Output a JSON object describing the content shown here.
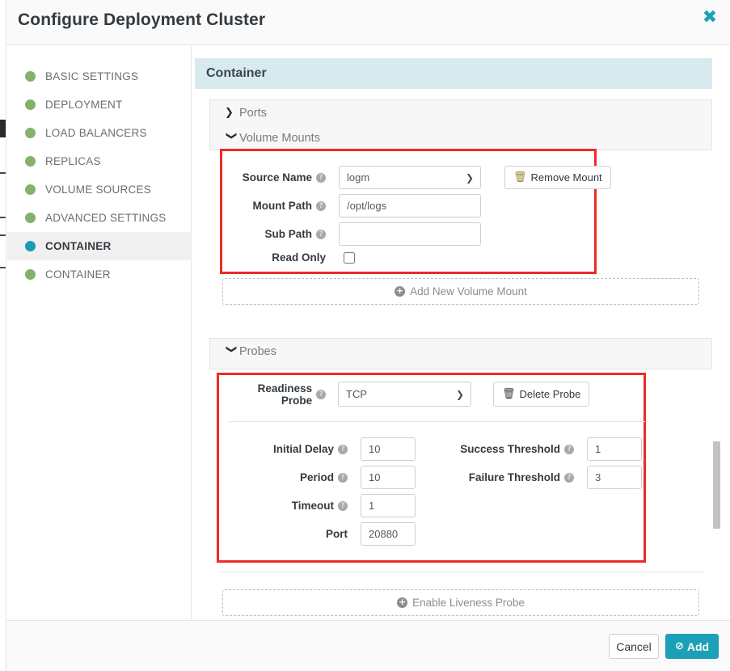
{
  "dialog": {
    "title": "Configure Deployment Cluster",
    "close_icon": "close-icon",
    "close_glyph": "✖"
  },
  "sidebar": {
    "items": [
      {
        "label": "BASIC SETTINGS",
        "status_color": "#84b269",
        "active": false
      },
      {
        "label": "DEPLOYMENT",
        "status_color": "#84b269",
        "active": false
      },
      {
        "label": "LOAD BALANCERS",
        "status_color": "#84b269",
        "active": false
      },
      {
        "label": "REPLICAS",
        "status_color": "#84b269",
        "active": false
      },
      {
        "label": "VOLUME SOURCES",
        "status_color": "#84b269",
        "active": false
      },
      {
        "label": "ADVANCED SETTINGS",
        "status_color": "#84b269",
        "active": false
      },
      {
        "label": "CONTAINER",
        "status_color": "#1b9cb5",
        "active": true
      },
      {
        "label": "CONTAINER",
        "status_color": "#84b269",
        "active": false
      }
    ]
  },
  "main": {
    "section_title": "Container",
    "accordions": {
      "ports": {
        "label": "Ports",
        "expanded": false,
        "chevron": "❯"
      },
      "volume_mounts": {
        "label": "Volume Mounts",
        "expanded": true,
        "chevron": "❯"
      },
      "probes": {
        "label": "Probes",
        "expanded": true,
        "chevron": "❯"
      }
    },
    "volume_mount": {
      "source_name": {
        "label": "Source Name",
        "value": "logm",
        "help": "?"
      },
      "mount_path": {
        "label": "Mount Path",
        "value": "/opt/logs",
        "help": "?"
      },
      "sub_path": {
        "label": "Sub Path",
        "value": "",
        "help": "?"
      },
      "read_only": {
        "label": "Read Only",
        "checked": false
      },
      "remove_button": {
        "label": "Remove Mount",
        "icon": "trash-icon",
        "glyph": "🗑"
      },
      "add_button": {
        "label": "Add New Volume Mount",
        "icon": "plus-circle-icon",
        "glyph": "+"
      }
    },
    "probes": {
      "readiness": {
        "label": "Readiness Probe",
        "value": "TCP",
        "help": "?",
        "delete_button": {
          "label": "Delete Probe",
          "icon": "trash-icon",
          "glyph": "🗑"
        }
      },
      "fields_left": [
        {
          "label": "Initial Delay",
          "value": "10",
          "help": "?"
        },
        {
          "label": "Period",
          "value": "10",
          "help": "?"
        },
        {
          "label": "Timeout",
          "value": "1",
          "help": "?"
        },
        {
          "label": "Port",
          "value": "20880",
          "help": ""
        }
      ],
      "fields_right": [
        {
          "label": "Success Threshold",
          "value": "1",
          "help": "?"
        },
        {
          "label": "Failure Threshold",
          "value": "3",
          "help": "?"
        }
      ],
      "liveness_button": {
        "label": "Enable Liveness Probe",
        "icon": "plus-circle-icon",
        "glyph": "+"
      }
    }
  },
  "footer": {
    "cancel_label": "Cancel",
    "add_label": "Add",
    "add_icon": "check-circle-icon",
    "add_glyph": "⊘"
  },
  "colors": {
    "accent_teal": "#1ba0b8",
    "status_green": "#84b269",
    "highlight_red": "#ee2a26",
    "banner_blue": "#d9eaef"
  }
}
